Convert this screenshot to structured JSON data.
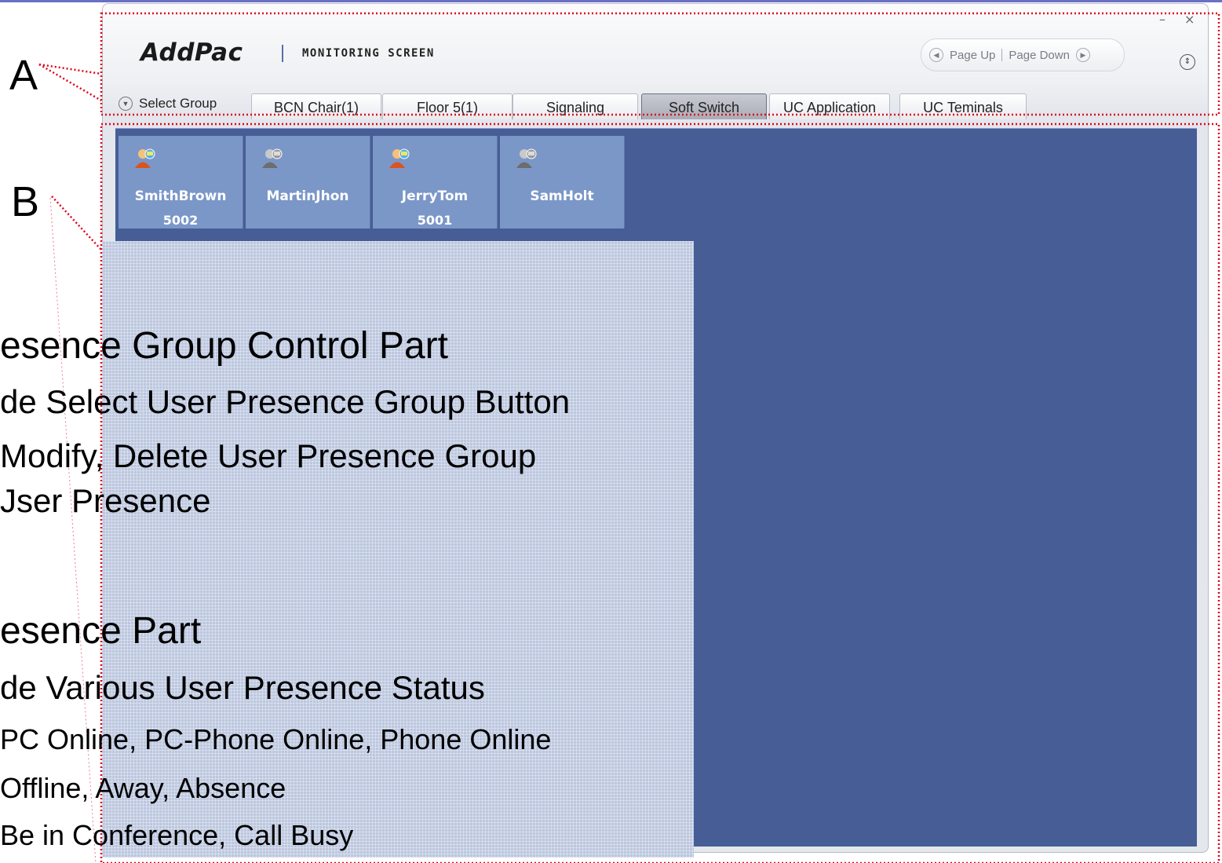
{
  "window": {
    "logo": "AddPac",
    "subtitle": "MONITORING SCREEN",
    "pager": {
      "page_up": "Page Up",
      "page_down": "Page Down"
    },
    "minimize": "–",
    "close": "×"
  },
  "group_bar": {
    "select_group": "Select Group",
    "tabs": [
      {
        "label": "BCN Chair(1)",
        "active": false
      },
      {
        "label": "Floor 5(1)",
        "active": false
      },
      {
        "label": "Signaling",
        "active": false
      },
      {
        "label": "Soft Switch",
        "active": true
      },
      {
        "label": "UC Application",
        "active": false
      },
      {
        "label": "UC Teminals",
        "active": false
      }
    ]
  },
  "users": [
    {
      "name": "SmithBrown",
      "ext": "5002",
      "status": "online",
      "icon": "user-online-icon"
    },
    {
      "name": "MartinJhon",
      "ext": "",
      "status": "offline",
      "icon": "user-offline-icon"
    },
    {
      "name": "JerryTom",
      "ext": "5001",
      "status": "online",
      "icon": "user-online-icon"
    },
    {
      "name": "SamHolt",
      "ext": "",
      "status": "offline",
      "icon": "user-offline-icon"
    }
  ],
  "annotations": {
    "a": "A",
    "b": "B"
  },
  "slide_text": {
    "l1": "esence Group Control Part",
    "l2": "de Select User Presence Group Button",
    "l3": " Modify, Delete User Presence Group",
    "l4": "Jser Presence",
    "l5": "esence Part",
    "l6": "de Various User Presence Status",
    "l7": "PC Online, PC-Phone Online, Phone Online",
    "l8": "Offline, Away, Absence",
    "l9": "Be in Conference, Call Busy"
  },
  "colors": {
    "presence_bg": "#465d96",
    "user_tile": "#7b97c8",
    "annotation_line": "#e0001a"
  }
}
